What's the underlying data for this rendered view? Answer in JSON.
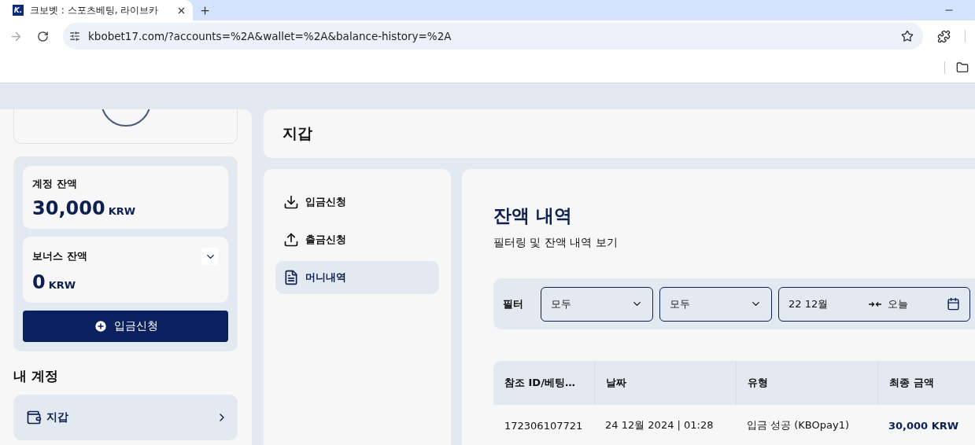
{
  "browser": {
    "tab_title": "크보벳 : 스포츠베팅, 라이브카",
    "favicon": "K.",
    "url": "kbobet17.com/?accounts=%2A&wallet=%2A&balance-history=%2A"
  },
  "sidebar": {
    "balances": [
      {
        "label": "계정 잔액",
        "amount": "30,000",
        "currency": "KRW",
        "expandable": false
      },
      {
        "label": "보너스 잔액",
        "amount": "0",
        "currency": "KRW",
        "expandable": true
      }
    ],
    "deposit_button": "입금신청",
    "section_title": "내 계정",
    "menu_items": [
      {
        "label": "지갑"
      }
    ]
  },
  "page_title": "지갑",
  "wallet_menu": [
    {
      "label": "입금신청",
      "kind": "download",
      "selected": false
    },
    {
      "label": "출금신청",
      "kind": "upload",
      "selected": false
    },
    {
      "label": "머니내역",
      "kind": "document",
      "selected": true
    }
  ],
  "content": {
    "title": "잔액 내역",
    "subtitle": "필터링 및 잔액 내역 보기",
    "filter": {
      "label": "필터",
      "selects": [
        {
          "value": "모두"
        },
        {
          "value": "모두"
        }
      ],
      "date_from": "22 12월",
      "date_to": "오늘"
    },
    "table": {
      "columns": [
        "참조 ID/베팅…",
        "날짜",
        "유형",
        "최종 금액"
      ],
      "rows": [
        [
          "172306107721",
          "24 12월 2024 | 01:28",
          "입금 성공 (KBOpay1)",
          "30,000 KRW"
        ]
      ]
    }
  }
}
